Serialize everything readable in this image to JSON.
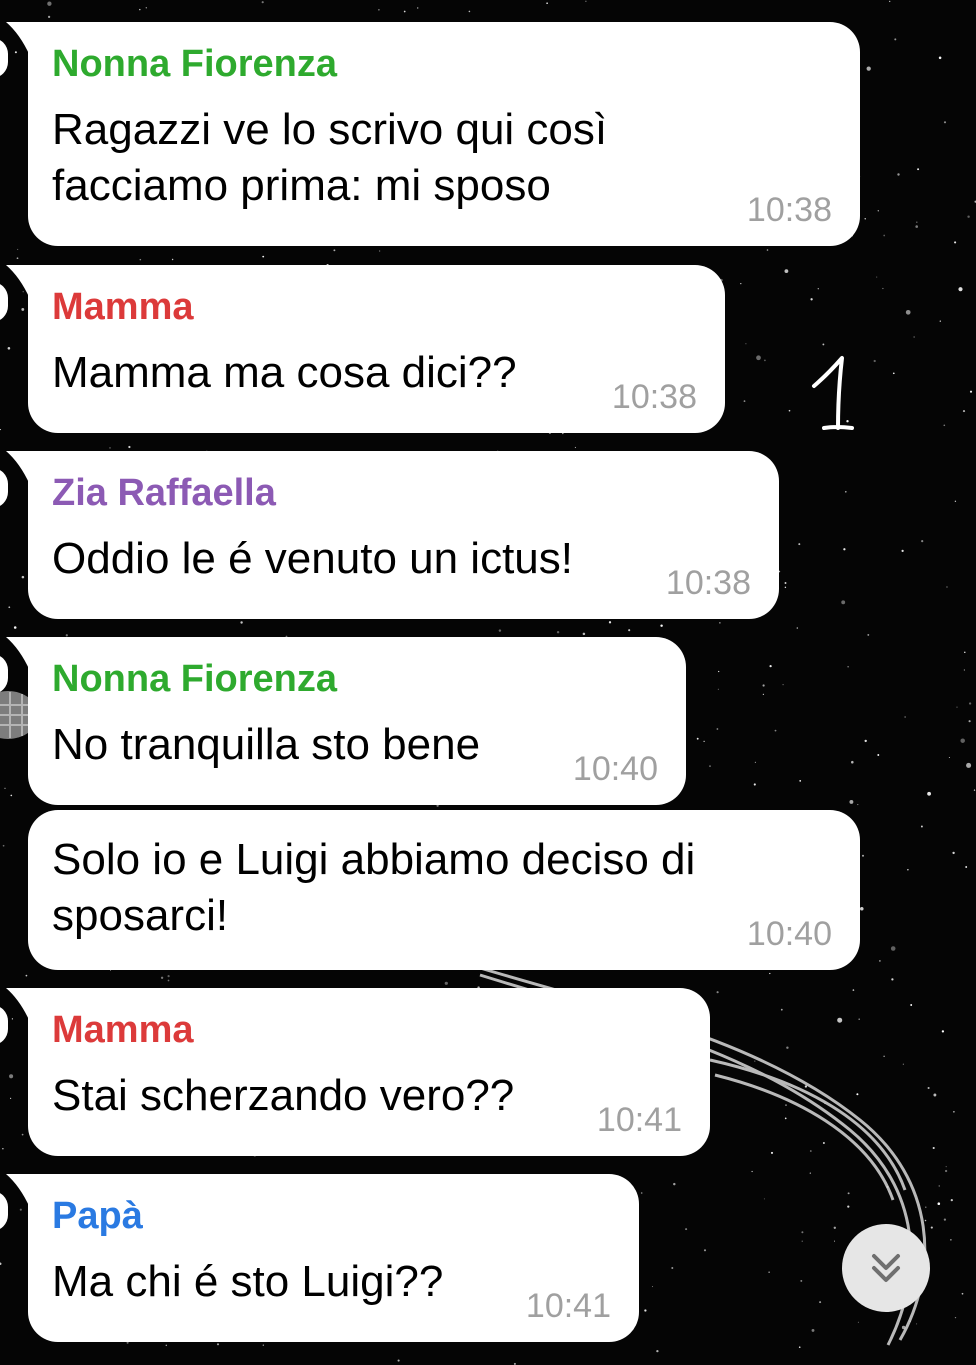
{
  "colors": {
    "background": "#050505",
    "bubble": "#ffffff",
    "time": "#a0a0a0",
    "text": "#000000",
    "scroll_button": "#e6e6e6"
  },
  "messages": [
    {
      "sender": "Nonna Fiorenza",
      "sender_color": "#2eaa2e",
      "lines": [
        "Ragazzi ve lo scrivo qui così",
        "facciamo prima: mi sposo"
      ],
      "time": "10:38"
    },
    {
      "sender": "Mamma",
      "sender_color": "#dc3a3a",
      "lines": [
        "Mamma ma cosa dici??"
      ],
      "time": "10:38"
    },
    {
      "sender": "Zia Raffaella",
      "sender_color": "#8c5ab4",
      "lines": [
        "Oddio le é venuto un ictus!"
      ],
      "time": "10:38"
    },
    {
      "sender": "Nonna Fiorenza",
      "sender_color": "#2eaa2e",
      "lines": [
        "No tranquilla sto bene"
      ],
      "time": "10:40"
    },
    {
      "sender": "",
      "sender_color": "#2eaa2e",
      "lines": [
        "Solo io e Luigi abbiamo deciso di",
        "sposarci!"
      ],
      "time": "10:40"
    },
    {
      "sender": "Mamma",
      "sender_color": "#dc3a3a",
      "lines": [
        "Stai scherzando vero??"
      ],
      "time": "10:41"
    },
    {
      "sender": "Papà",
      "sender_color": "#2a7ae2",
      "lines": [
        "Ma chi é sto Luigi??"
      ],
      "time": "10:41"
    }
  ],
  "annotation": {
    "icon": "handwritten-number"
  },
  "scroll_button": {
    "icon": "chevron-double-down-icon"
  }
}
